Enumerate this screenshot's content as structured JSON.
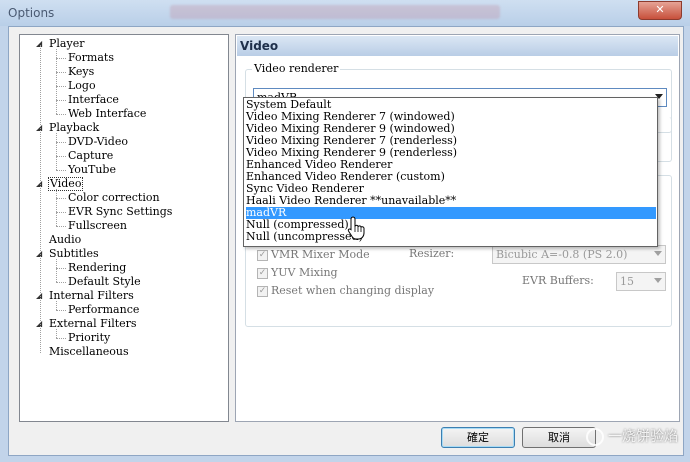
{
  "window": {
    "title": "Options",
    "close_glyph": "✕"
  },
  "tree": {
    "items": [
      {
        "label": "Player",
        "level": 0,
        "expander": "open"
      },
      {
        "label": "Formats",
        "level": 1
      },
      {
        "label": "Keys",
        "level": 1
      },
      {
        "label": "Logo",
        "level": 1
      },
      {
        "label": "Interface",
        "level": 1
      },
      {
        "label": "Web Interface",
        "level": 1
      },
      {
        "label": "Playback",
        "level": 0,
        "expander": "open"
      },
      {
        "label": "DVD-Video",
        "level": 1
      },
      {
        "label": "Capture",
        "level": 1
      },
      {
        "label": "YouTube",
        "level": 1
      },
      {
        "label": "Video",
        "level": 0,
        "expander": "open",
        "selected": true
      },
      {
        "label": "Color correction",
        "level": 1
      },
      {
        "label": "EVR Sync Settings",
        "level": 1
      },
      {
        "label": "Fullscreen",
        "level": 1
      },
      {
        "label": "Audio",
        "level": 0
      },
      {
        "label": "Subtitles",
        "level": 0,
        "expander": "open"
      },
      {
        "label": "Rendering",
        "level": 1
      },
      {
        "label": "Default Style",
        "level": 1
      },
      {
        "label": "Internal Filters",
        "level": 0,
        "expander": "open"
      },
      {
        "label": "Performance",
        "level": 1
      },
      {
        "label": "External Filters",
        "level": 0,
        "expander": "open"
      },
      {
        "label": "Priority",
        "level": 1
      },
      {
        "label": "Miscellaneous",
        "level": 0
      }
    ]
  },
  "panel": {
    "header": "Video",
    "renderer_group_label": "Video renderer",
    "renderer_selected": "madVR",
    "dropdown_options": [
      "System Default",
      "Video Mixing Renderer 7 (windowed)",
      "Video Mixing Renderer 9 (windowed)",
      "Video Mixing Renderer 7 (renderless)",
      "Video Mixing Renderer 9 (renderless)",
      "Enhanced Video Renderer",
      "Enhanced Video Renderer (custom)",
      "Sync Video Renderer",
      "Haali Video Renderer **unavailable**",
      "madVR",
      "Null (compressed)",
      "Null (uncompressed)"
    ],
    "highlighted_option_index": 9,
    "vmr_mixer_mode_label": "VMR Mixer Mode",
    "yuv_mixing_label": "YUV Mixing",
    "reset_display_label": "Reset when changing display",
    "resizer_label": "Resizer:",
    "resizer_value": "Bicubic A=-0.8 (PS 2.0)",
    "evr_buffers_label": "EVR Buffers:",
    "evr_buffers_value": "15"
  },
  "buttons": {
    "ok": "確定",
    "cancel": "取消"
  },
  "watermark": {
    "text": "一烧饼验焰"
  },
  "colors": {
    "highlight": "#3399ff",
    "header_gradient_top": "#dbe7f4",
    "header_gradient_bottom": "#b9cde6"
  }
}
